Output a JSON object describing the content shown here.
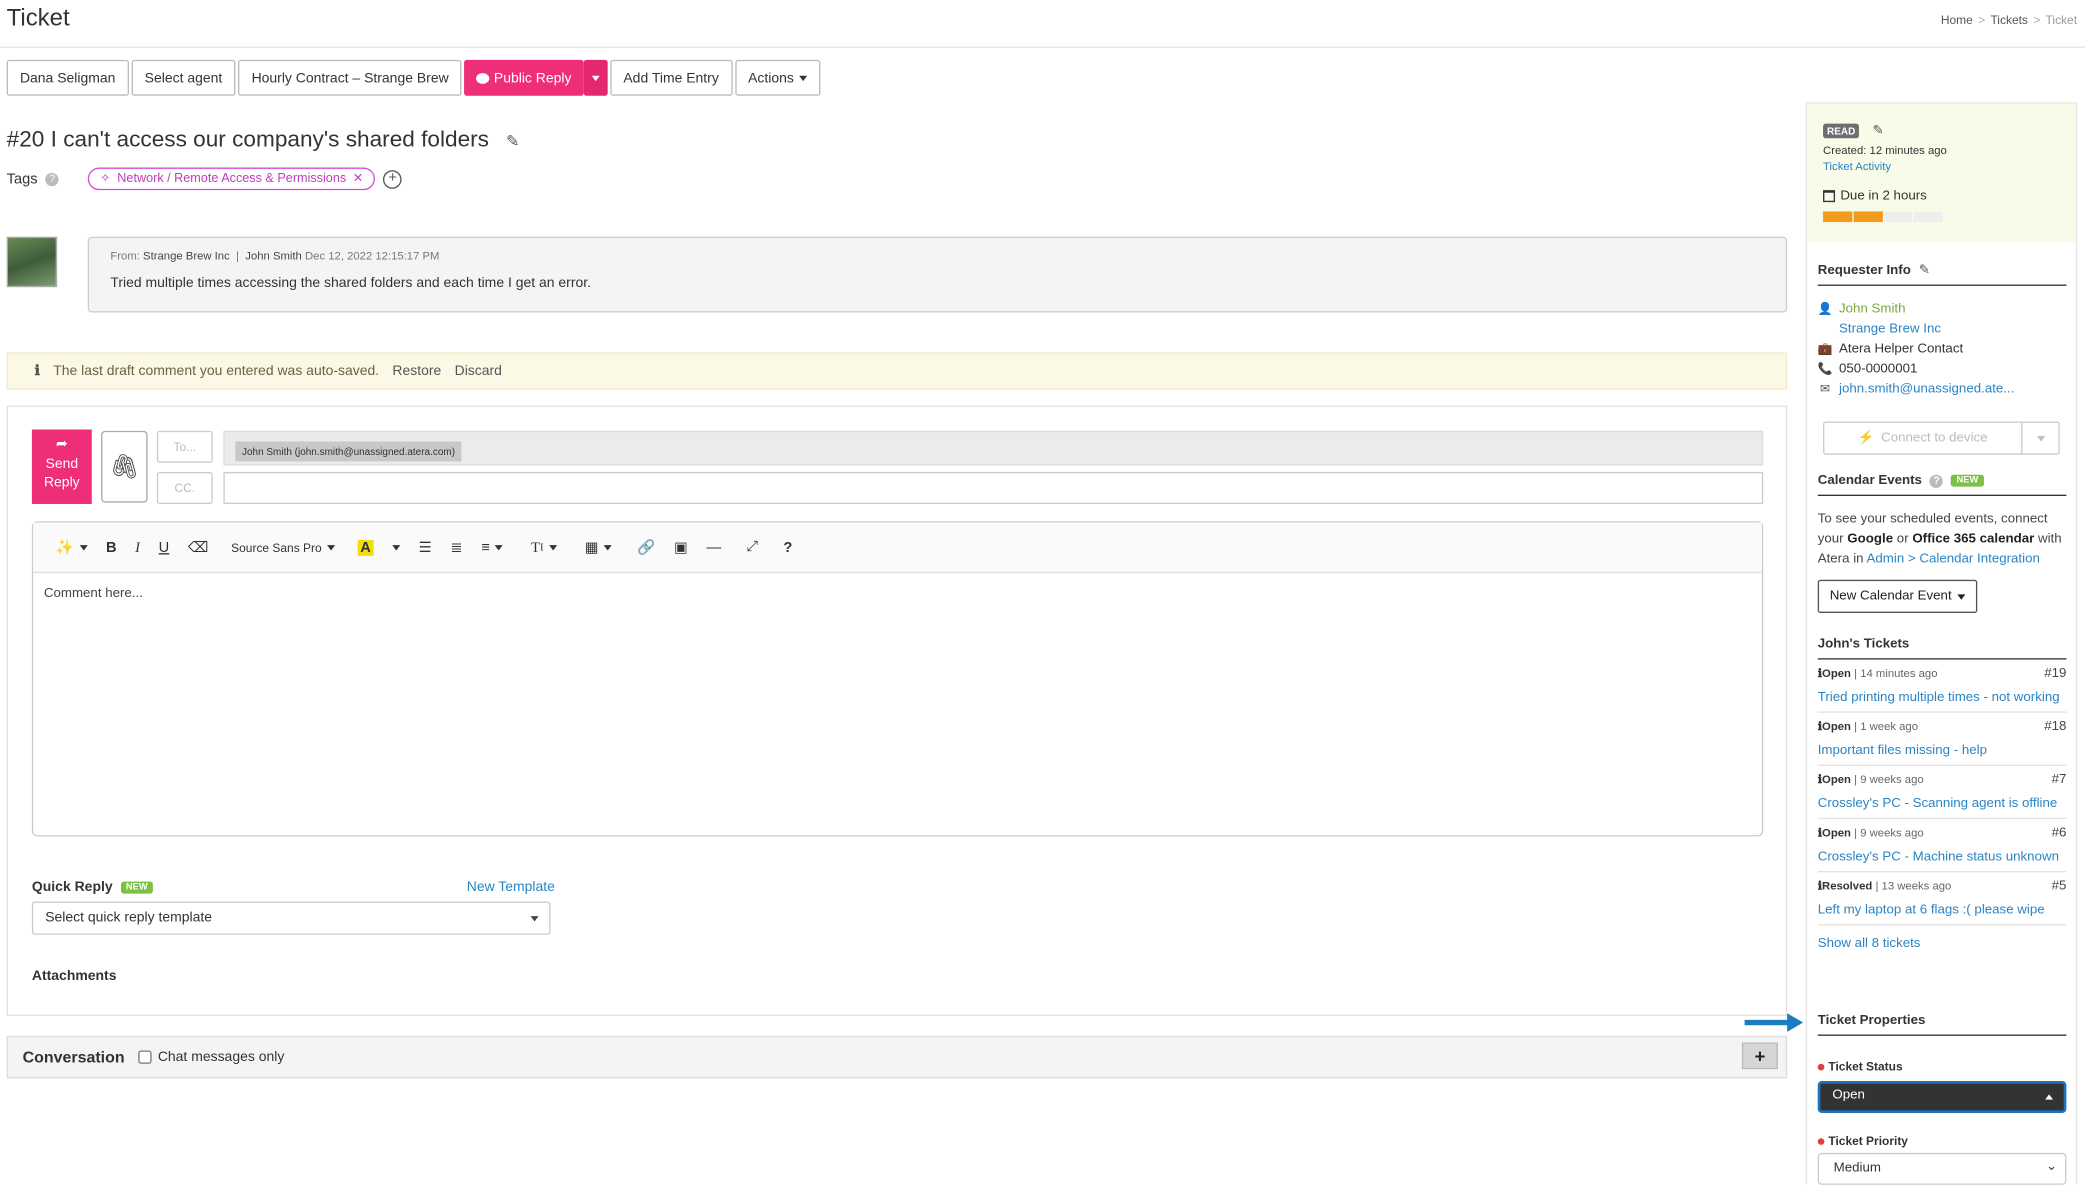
{
  "header": {
    "title": "Ticket",
    "breadcrumb": [
      "Home",
      "Tickets",
      "Ticket"
    ],
    "breadcrumb_sep": ">"
  },
  "toolbar": {
    "contact": "Dana Seligman",
    "agent": "Select agent",
    "contract": "Hourly Contract – Strange Brew",
    "public_reply": "Public Reply",
    "add_time": "Add Time Entry",
    "actions": "Actions"
  },
  "ticket": {
    "title": "#20 I can't access our company's shared folders",
    "tags_label": "Tags",
    "tag": "Network / Remote Access & Permissions"
  },
  "message": {
    "from_label": "From:",
    "company": "Strange Brew Inc",
    "sep": "|",
    "author": "John Smith",
    "date": "Dec 12, 2022 12:15:17 PM",
    "body": "Tried multiple times accessing the shared folders and each time I get an error."
  },
  "autosave": {
    "text": "The last draft comment you entered was auto-saved.",
    "restore": "Restore",
    "discard": "Discard"
  },
  "reply": {
    "send_line1": "Send",
    "send_line2": "Reply",
    "to_placeholder": "To...",
    "cc_placeholder": "CC.",
    "recipient": "John Smith (john.smith@unassigned.atera.com)",
    "font": "Source Sans Pro",
    "comment_placeholder": "Comment here...",
    "quick_reply_label": "Quick Reply",
    "new_badge": "NEW",
    "new_template": "New Template",
    "quick_reply_select": "Select quick reply template",
    "attachments_label": "Attachments"
  },
  "conversation": {
    "title": "Conversation",
    "chat_only": "Chat messages only"
  },
  "sidebar": {
    "read_badge": "READ",
    "created": "Created: 12 minutes ago",
    "activity_link": "Ticket Activity",
    "due": "Due in 2 hours",
    "due_progress": 0.5,
    "requester": {
      "title": "Requester Info",
      "name": "John Smith",
      "company": "Strange Brew Inc",
      "contact_type": "Atera Helper Contact",
      "phone": "050-0000001",
      "email": "john.smith@unassigned.ate..."
    },
    "connect": "Connect to device",
    "calendar": {
      "title": "Calendar Events",
      "badge": "NEW",
      "text_1": "To see your scheduled events, connect your ",
      "google": "Google",
      "or": " or ",
      "office": "Office 365 calendar",
      "text_2": " with Atera in ",
      "link": "Admin > Calendar Integration",
      "button": "New Calendar Event"
    },
    "johns_tickets": {
      "title": "John's Tickets",
      "items": [
        {
          "status": "Open",
          "time": "14 minutes ago",
          "num": "#19",
          "subject": "Tried printing multiple times - not working"
        },
        {
          "status": "Open",
          "time": "1 week ago",
          "num": "#18",
          "subject": "Important files missing - help"
        },
        {
          "status": "Open",
          "time": "9 weeks ago",
          "num": "#7",
          "subject": "Crossley's PC - Scanning agent is offline"
        },
        {
          "status": "Open",
          "time": "9 weeks ago",
          "num": "#6",
          "subject": "Crossley's PC - Machine status unknown"
        },
        {
          "status": "Resolved",
          "time": "13 weeks ago",
          "num": "#5",
          "subject": "Left my laptop at 6 flags :( please wipe"
        }
      ],
      "show_all": "Show all 8 tickets"
    },
    "properties": {
      "title": "Ticket Properties",
      "status_label": "Ticket Status",
      "status_value": "Open",
      "priority_label": "Ticket Priority",
      "priority_value": "Medium"
    }
  },
  "colors": {
    "brand_pink": "#ef2e7a",
    "link_blue": "#2a84c4",
    "new_green": "#7bc142",
    "due_orange": "#f59b1c",
    "arrow_blue": "#1a7dc0"
  }
}
